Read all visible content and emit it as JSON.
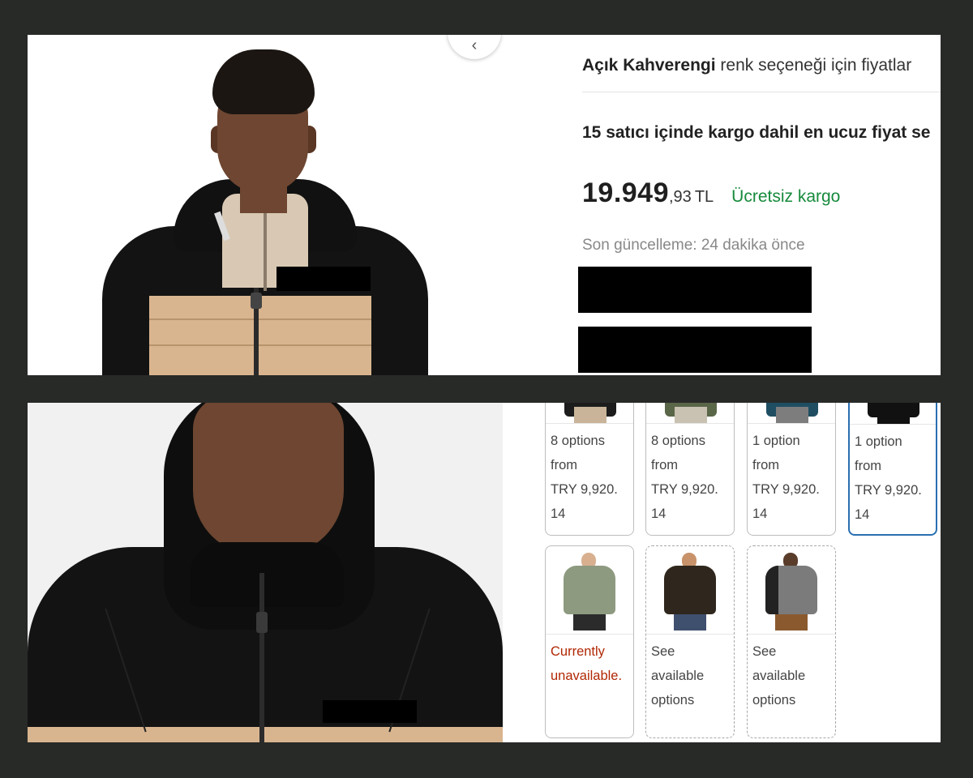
{
  "top": {
    "color_label_bold": "Açık Kahverengi",
    "color_label_rest": " renk seçeneği için fiyatlar",
    "sellers_text": "15 satıcı içinde kargo dahil en ucuz fiyat se",
    "price_main": "19.949",
    "price_decimal": ",93",
    "price_currency": "TL",
    "free_shipping": "Ücretsiz kargo",
    "last_update": "Son güncelleme: 24 dakika önce",
    "back_icon": "chevron-left-icon"
  },
  "options": [
    {
      "line1": "8 options",
      "line2": "from",
      "line3": "TRY 9,920.",
      "line4": "14",
      "jacket_color": "#1c1c1c",
      "pants_color": "#c9b49a",
      "selected": false
    },
    {
      "line1": "8 options",
      "line2": "from",
      "line3": "TRY 9,920.",
      "line4": "14",
      "jacket_color": "#5a6648",
      "pants_color": "#c9c1b1",
      "selected": false
    },
    {
      "line1": "1 option",
      "line2": "from",
      "line3": "TRY 9,920.",
      "line4": "14",
      "jacket_color": "#1f4e63",
      "pants_color": "#7d7d7d",
      "selected": false
    },
    {
      "line1": "1 option",
      "line2": "from",
      "line3": "TRY 9,920.",
      "line4": "14",
      "jacket_color": "#111111",
      "pants_color": "#111111",
      "selected": true
    }
  ],
  "variants": [
    {
      "line1": "Currently",
      "line2": "unavailable.",
      "line3": "",
      "status": "unavailable",
      "jacket_color": "#8d9a80",
      "pants_color": "#2b2b2b",
      "head_color": "#d8b090"
    },
    {
      "line1": "See",
      "line2": "available",
      "line3": "options",
      "status": "available",
      "jacket_color": "#2f271d",
      "pants_color": "#3f4f6e",
      "head_color": "#c8926a"
    },
    {
      "line1": "See",
      "line2": "available",
      "line3": "options",
      "status": "available",
      "jacket_color": "#7b7b7b",
      "pants_color": "#8a5a2e",
      "head_color": "#5a3c2a"
    }
  ],
  "colors": {
    "price_green": "#178a3c",
    "unavailable_red": "#b12704",
    "selected_blue": "#2a6fb0",
    "jacket_tan": "#d9b58f",
    "jacket_black": "#131313"
  }
}
